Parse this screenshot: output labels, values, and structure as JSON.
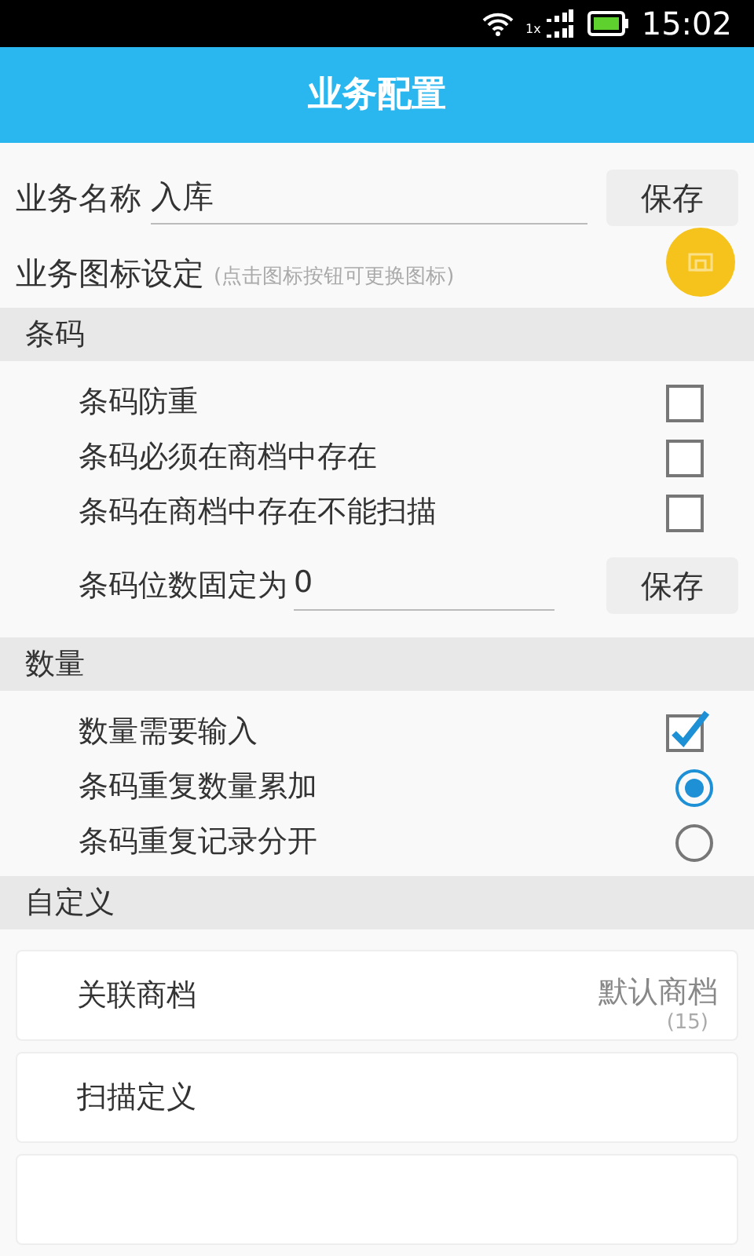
{
  "status_bar": {
    "network": "1x",
    "time": "15:02"
  },
  "header": {
    "title": "业务配置"
  },
  "name_row": {
    "label": "业务名称",
    "value": "入库",
    "button": "保存"
  },
  "icon_row": {
    "label": "业务图标设定",
    "hint": "(点击图标按钮可更换图标)"
  },
  "sections": [
    {
      "title": "条码",
      "items": [
        {
          "kind": "checkbox",
          "label": "条码防重",
          "checked": false
        },
        {
          "kind": "checkbox",
          "label": "条码必须在商档中存在",
          "checked": false
        },
        {
          "kind": "checkbox",
          "label": "条码在商档中存在不能扫描",
          "checked": false
        },
        {
          "kind": "field",
          "label": "条码位数固定为",
          "value": "0",
          "button": "保存"
        }
      ]
    },
    {
      "title": "数量",
      "items": [
        {
          "kind": "checkbox",
          "label": "数量需要输入",
          "checked": true
        },
        {
          "kind": "radio",
          "label": "条码重复数量累加",
          "selected": true
        },
        {
          "kind": "radio",
          "label": "条码重复记录分开",
          "selected": false
        }
      ]
    },
    {
      "title": "自定义",
      "items": [
        {
          "kind": "card",
          "label": "关联商档",
          "value": "默认商档",
          "count": "(15)"
        },
        {
          "kind": "card",
          "label": "扫描定义"
        },
        {
          "kind": "card"
        }
      ]
    }
  ]
}
